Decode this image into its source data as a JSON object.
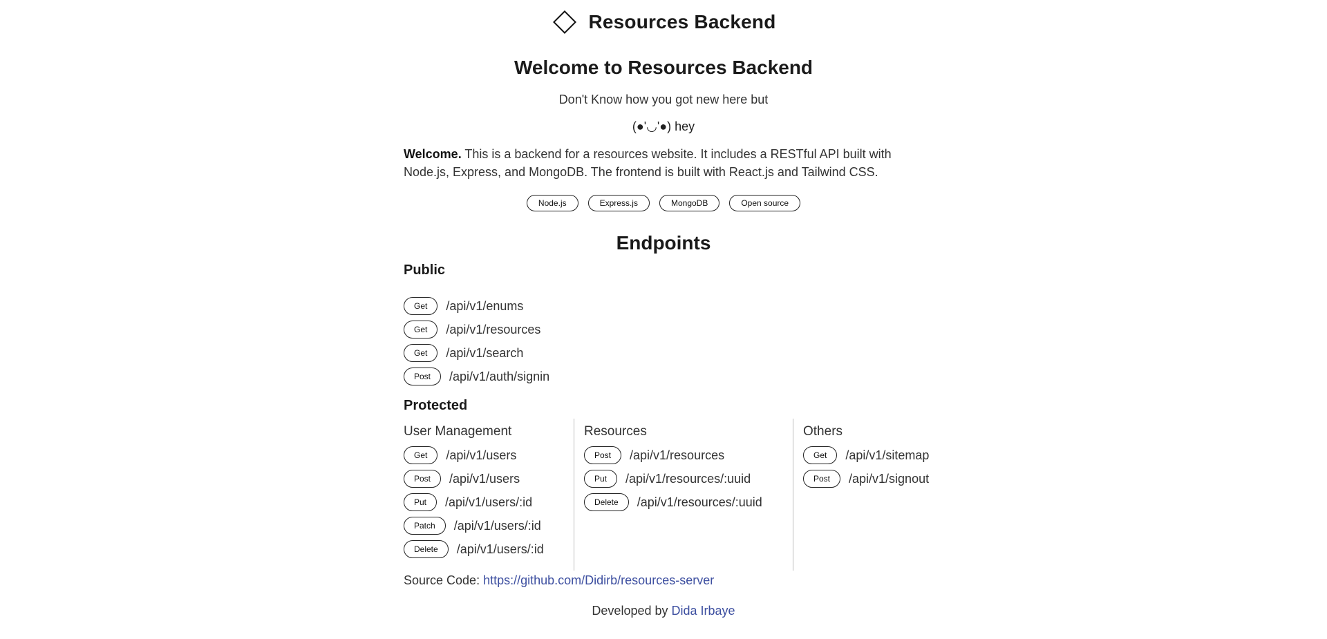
{
  "header": {
    "brand_icon": "diamond-icon",
    "brand_title": "Resources Backend"
  },
  "welcome": {
    "title": "Welcome to Resources Backend",
    "line1": "Don't Know how you got new here but",
    "line2": "(●'◡'●) hey",
    "intro_bold": "Welcome.",
    "intro_text": " This is a backend for a resources website. It includes a RESTful API built with Node.js, Express, and MongoDB. The frontend is built with React.js and Tailwind CSS."
  },
  "tags": [
    "Node.js",
    "Express.js",
    "MongoDB",
    "Open source"
  ],
  "endpoints": {
    "title": "Endpoints",
    "public": {
      "title": "Public",
      "items": [
        {
          "method": "Get",
          "path": "/api/v1/enums"
        },
        {
          "method": "Get",
          "path": "/api/v1/resources"
        },
        {
          "method": "Get",
          "path": "/api/v1/search"
        },
        {
          "method": "Post",
          "path": "/api/v1/auth/signin"
        }
      ]
    },
    "protected": {
      "title": "Protected",
      "groups": [
        {
          "title": "User Management",
          "items": [
            {
              "method": "Get",
              "path": "/api/v1/users"
            },
            {
              "method": "Post",
              "path": "/api/v1/users"
            },
            {
              "method": "Put",
              "path": "/api/v1/users/:id"
            },
            {
              "method": "Patch",
              "path": "/api/v1/users/:id"
            },
            {
              "method": "Delete",
              "path": "/api/v1/users/:id"
            }
          ]
        },
        {
          "title": "Resources",
          "items": [
            {
              "method": "Post",
              "path": "/api/v1/resources"
            },
            {
              "method": "Put",
              "path": "/api/v1/resources/:uuid"
            },
            {
              "method": "Delete",
              "path": "/api/v1/resources/:uuid"
            }
          ]
        },
        {
          "title": "Others",
          "items": [
            {
              "method": "Get",
              "path": "/api/v1/sitemap"
            },
            {
              "method": "Post",
              "path": "/api/v1/signout"
            }
          ]
        }
      ]
    }
  },
  "footer": {
    "source_label": "Source Code: ",
    "source_link": "https://github.com/Didirb/resources-server",
    "developed_label": "Developed by ",
    "developer": "Dida Irbaye"
  },
  "colors": {
    "link": "#3d4fa0",
    "text": "#1a1a1a",
    "border": "#222222"
  }
}
